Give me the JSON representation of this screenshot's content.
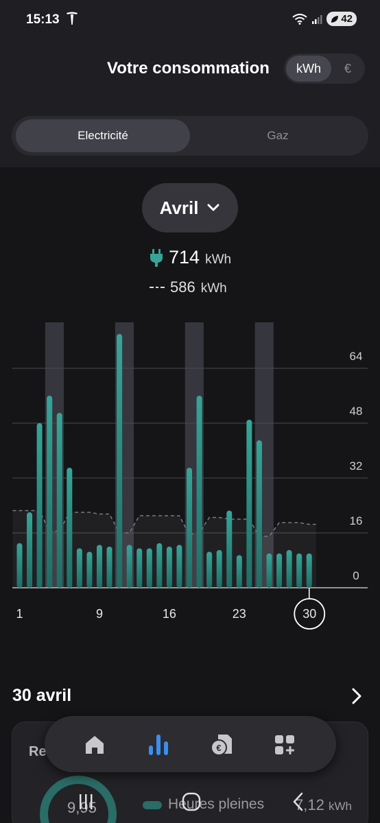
{
  "status_bar": {
    "time": "15:13",
    "battery": "42"
  },
  "header": {
    "title": "Votre consommation",
    "unit_options": [
      "kWh",
      "€"
    ],
    "selected_unit": "kWh"
  },
  "energy_tabs": {
    "items": [
      "Electricité",
      "Gaz"
    ],
    "selected": "Electricité"
  },
  "period": {
    "month": "Avril"
  },
  "summary": {
    "total_value": "714",
    "total_unit": "kWh",
    "reference_value": "586",
    "reference_unit": "kWh"
  },
  "chart_data": {
    "type": "bar",
    "x": [
      1,
      2,
      3,
      4,
      5,
      6,
      7,
      8,
      9,
      10,
      11,
      12,
      13,
      14,
      15,
      16,
      17,
      18,
      19,
      20,
      21,
      22,
      23,
      24,
      25,
      26,
      27,
      28,
      29,
      30
    ],
    "x_tick_labels": [
      "1",
      "9",
      "16",
      "23",
      "30"
    ],
    "selected_day": 30,
    "values": [
      13,
      22,
      48,
      56,
      51,
      35,
      11.5,
      10.5,
      12.5,
      12,
      74,
      12.5,
      11.5,
      11.5,
      13,
      12,
      12.5,
      35,
      56,
      10.5,
      11,
      22.5,
      9.5,
      49,
      43,
      10,
      10,
      11,
      10,
      10
    ],
    "reference_line": [
      22.5,
      22.5,
      22.5,
      16.5,
      16.5,
      22,
      22,
      22,
      21.5,
      21.5,
      16,
      16,
      21,
      21,
      21,
      21,
      21,
      15.5,
      16,
      20.5,
      20.5,
      20,
      20,
      20,
      15,
      15,
      19,
      19,
      19,
      18.5
    ],
    "highlighted_ranges": [
      [
        4,
        5
      ],
      [
        11,
        12
      ],
      [
        18,
        19
      ],
      [
        25,
        26
      ]
    ],
    "y_ticks": [
      0,
      16,
      32,
      48,
      64
    ],
    "ylim": [
      0,
      80
    ],
    "bar_color": "#36a598",
    "grid": true
  },
  "day_detail": {
    "date": "30 avril",
    "card_title": "Re",
    "gauge_value": "9,95",
    "legend_label": "Heures pleines",
    "legend_value": "7,12",
    "legend_unit": "kWh"
  },
  "bottom_nav": {
    "items": [
      "home-icon",
      "chart-icon",
      "euro-document-icon",
      "add-widget-icon"
    ],
    "active": "chart-icon"
  },
  "colors": {
    "accent": "#36a598",
    "nav_active": "#3b8ef0",
    "background": "#151518",
    "header": "#1f1f23"
  }
}
